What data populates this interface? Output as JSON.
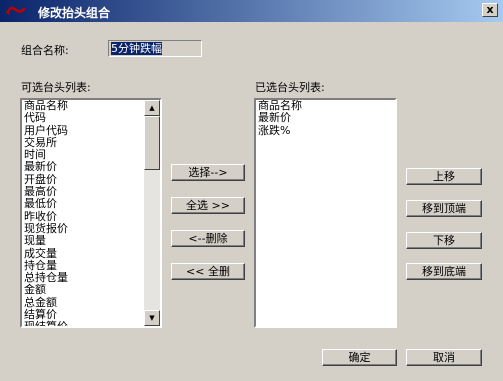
{
  "window": {
    "title": "修改抬头组合",
    "close_label": "x"
  },
  "form": {
    "name_label": "组合名称:",
    "name_value": "5分钟跌幅",
    "available_label": "可选台头列表:",
    "selected_label": "已选台头列表:"
  },
  "available_items": [
    "商品名称",
    "代码",
    "用户代码",
    "交易所",
    "时间",
    "最新价",
    "开盘价",
    "最高价",
    "最低价",
    "昨收价",
    "现货报价",
    "现量",
    "成交量",
    "持仓量",
    "总持仓量",
    "金额",
    "总金额",
    "结算价",
    "现结算价"
  ],
  "selected_items": [
    "商品名称",
    "最新价",
    "涨跌%"
  ],
  "buttons": {
    "select": "选择-->",
    "select_all": "全选 >>",
    "remove": "<--删除",
    "remove_all": "<< 全删",
    "move_up": "上移",
    "move_top": "移到顶端",
    "move_down": "下移",
    "move_bottom": "移到底端",
    "ok": "确定",
    "cancel": "取消"
  },
  "icons": {
    "scroll_up": "▲",
    "scroll_down": "▼"
  },
  "colors": {
    "titlebar_start": "#0a246a",
    "titlebar_end": "#a6caf0",
    "dialog_bg": "#d4d0c8",
    "selection": "#0a246a"
  }
}
